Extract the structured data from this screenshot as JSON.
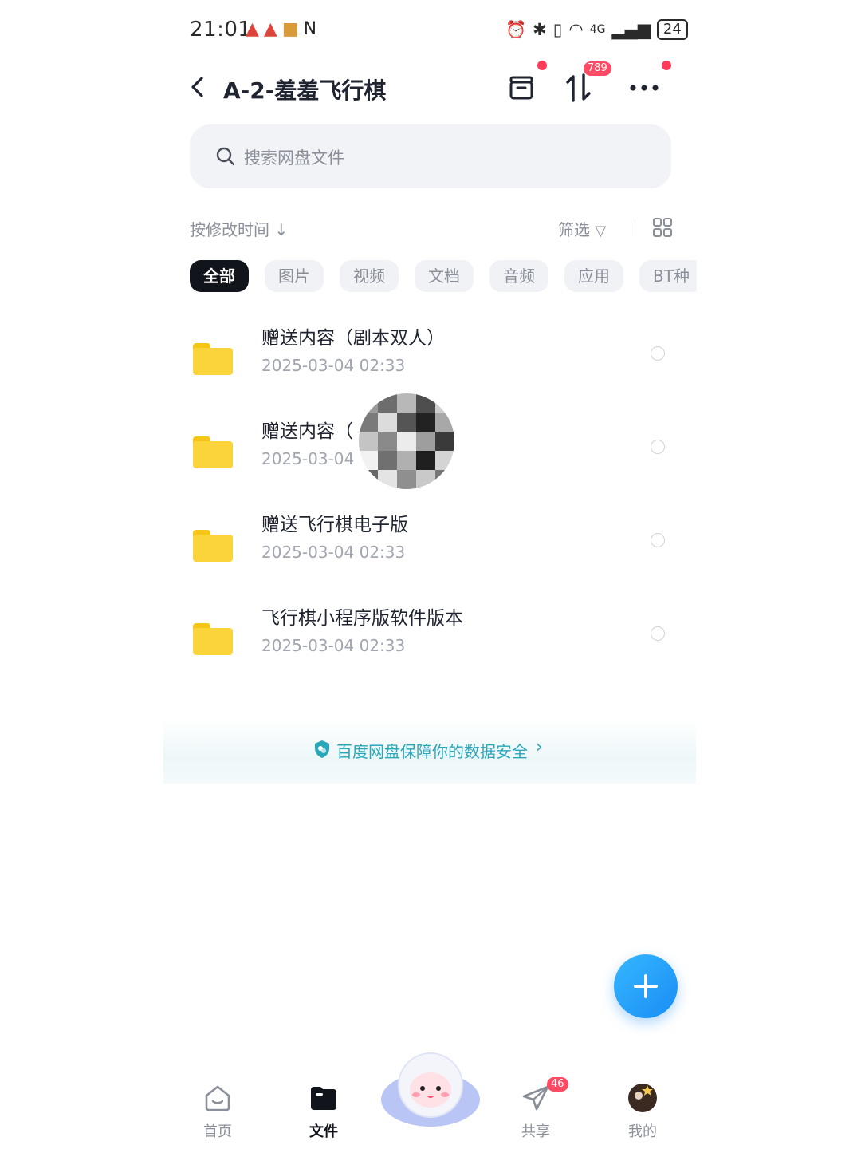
{
  "status_bar": {
    "time": "21:01",
    "network": "4G",
    "battery": "24"
  },
  "header": {
    "title": "A-2-羞羞飞行棋",
    "transfer_badge": "789"
  },
  "search": {
    "placeholder": "搜索网盘文件"
  },
  "toolbar": {
    "sort_label": "按修改时间",
    "filter_label": "筛选"
  },
  "tabs": [
    {
      "label": "全部",
      "active": true
    },
    {
      "label": "图片"
    },
    {
      "label": "视频"
    },
    {
      "label": "文档"
    },
    {
      "label": "音频"
    },
    {
      "label": "应用"
    },
    {
      "label": "BT种"
    }
  ],
  "files": [
    {
      "name": "赠送内容（剧本双人）",
      "date": "2025-03-04  02:33"
    },
    {
      "name": "赠送内容（",
      "date": "2025-03-04"
    },
    {
      "name": "赠送飞行棋电子版",
      "date": "2025-03-04  02:33"
    },
    {
      "name": "飞行棋小程序版软件版本",
      "date": "2025-03-04  02:33"
    }
  ],
  "security_banner": {
    "text": "百度网盘保障你的数据安全"
  },
  "bottom_nav": {
    "home": "首页",
    "files": "文件",
    "share": "共享",
    "share_badge": "46",
    "mine": "我的"
  },
  "colors": {
    "accent": "#1a8df5",
    "folder": "#fbd33a",
    "badge": "#ff4a63",
    "security": "#2aa7b8"
  }
}
